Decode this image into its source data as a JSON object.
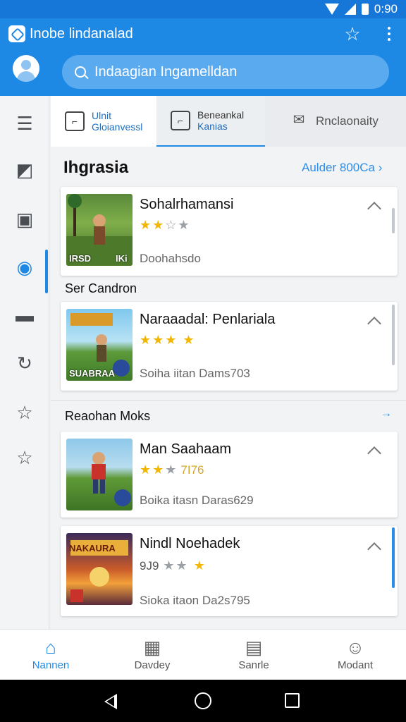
{
  "status_bar": {
    "time": "0:90"
  },
  "app_bar": {
    "title": "Inobe lindanalad",
    "search_placeholder": "Indaagian Ingamelldan"
  },
  "tabs": [
    {
      "line1": "Ulnit",
      "line2": "Gloianvessl"
    },
    {
      "line1": "Beneankal",
      "line2": "Kanias"
    },
    {
      "line1": "Rnclaonaity",
      "line2": ""
    }
  ],
  "sections": {
    "first": {
      "title": "Ihgrasia",
      "link": "Aulder 800Ca"
    },
    "second": {
      "title": "Ser Candron"
    },
    "third": {
      "title": "Reaohan Moks"
    }
  },
  "cards": [
    {
      "title": "Sohalrhamansi",
      "meta": "Doohahsdo",
      "thumb_label": "IRSD",
      "thumb_badge": "IKi",
      "rating_text": "",
      "rating_prefix": ""
    },
    {
      "title": "Naraaadal: Penlariala",
      "meta": "Soiha iitan  Dams703",
      "thumb_label": "SUABRAA",
      "thumb_badge": "",
      "rating_text": "",
      "rating_prefix": ""
    },
    {
      "title": "Man Saahaam",
      "meta": "Boika itasn  Daras629",
      "thumb_label": "",
      "thumb_badge": "",
      "rating_text": "7I76",
      "rating_prefix": ""
    },
    {
      "title": "Nindl Noehadek",
      "meta": "Sioka itaon  Da2s795",
      "thumb_label": "NAKAURA",
      "thumb_badge": "",
      "rating_text": "",
      "rating_prefix": "9J9"
    }
  ],
  "bottom_nav": [
    {
      "label": "Nannen",
      "icon": "home-icon"
    },
    {
      "label": "Davdey",
      "icon": "calendar-icon"
    },
    {
      "label": "Sanrle",
      "icon": "document-icon"
    },
    {
      "label": "Modant",
      "icon": "profile-icon"
    }
  ],
  "colors": {
    "primary": "#1e88e5",
    "status_bar": "#1677d9",
    "star": "#f2b705"
  }
}
